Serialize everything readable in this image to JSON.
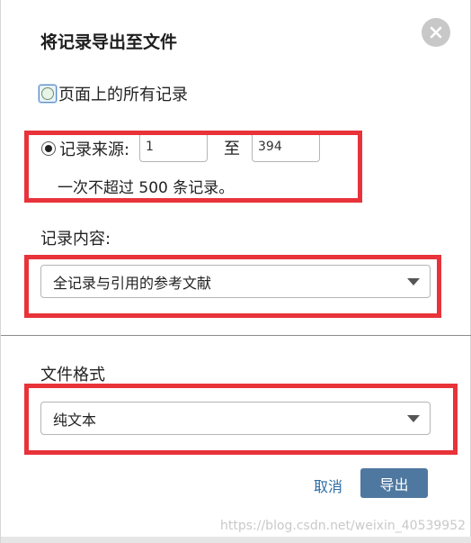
{
  "dialog": {
    "title": "将记录导出至文件",
    "close_icon": "close-icon"
  },
  "scope": {
    "all_records_label": "页面上的所有记录",
    "range_label": "记录来源:",
    "range_from": "1",
    "range_to_label": "至",
    "range_to": "394",
    "limit_note": "一次不超过 500 条记录。",
    "selected": "range"
  },
  "content": {
    "label": "记录内容:",
    "selected_option": "全记录与引用的参考文献"
  },
  "format": {
    "label": "文件格式",
    "selected_option": "纯文本"
  },
  "actions": {
    "cancel_label": "取消",
    "export_label": "导出"
  },
  "watermark": "https://blog.csdn.net/weixin_40539952",
  "colors": {
    "annotation_red": "#e8333a",
    "primary_button": "#4f78a0",
    "link": "#2b6ca3"
  }
}
